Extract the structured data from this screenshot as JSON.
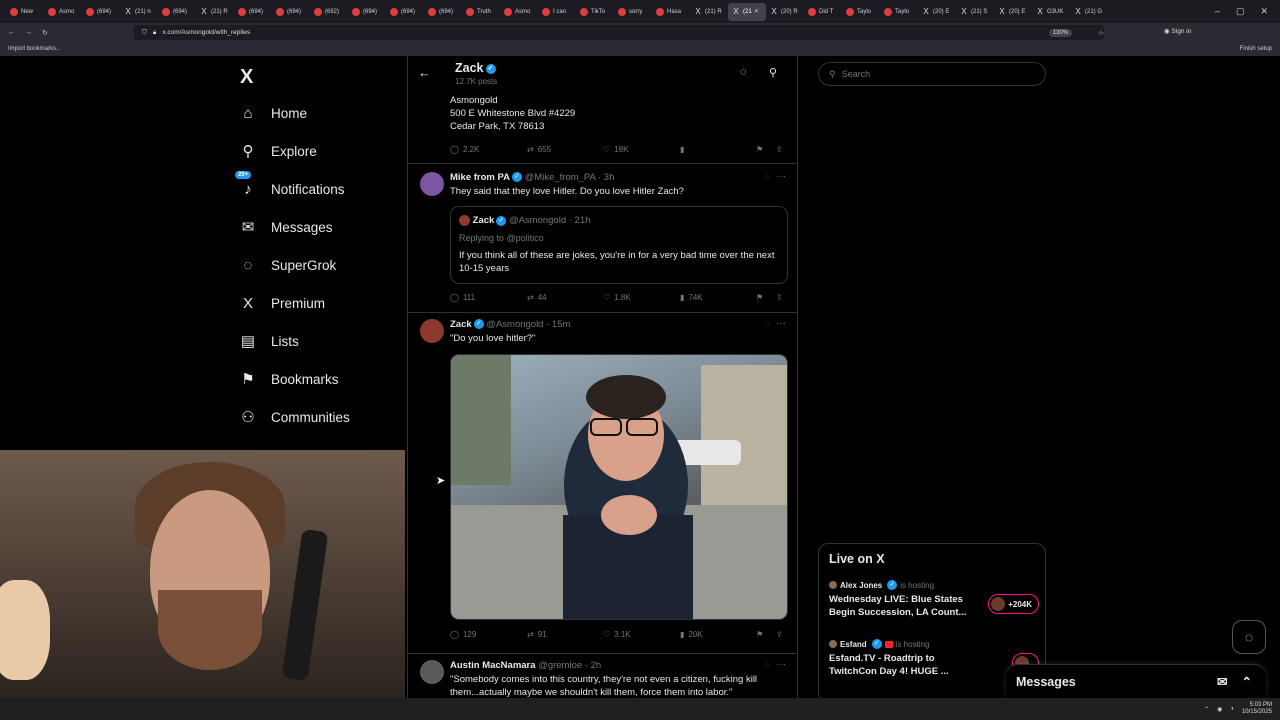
{
  "browser": {
    "tabs": [
      {
        "label": "New"
      },
      {
        "label": "Asmo"
      },
      {
        "label": "(694)"
      },
      {
        "label": "(21) n"
      },
      {
        "label": "(694)"
      },
      {
        "label": "(21) R"
      },
      {
        "label": "(694)"
      },
      {
        "label": "(694)"
      },
      {
        "label": "(692)"
      },
      {
        "label": "(694)"
      },
      {
        "label": "(694)"
      },
      {
        "label": "(694)"
      },
      {
        "label": "Truth"
      },
      {
        "label": "Asmo"
      },
      {
        "label": "I can"
      },
      {
        "label": "TikTo"
      },
      {
        "label": "sorry"
      },
      {
        "label": "Hasa"
      },
      {
        "label": "(21) R"
      },
      {
        "label": "(21"
      },
      {
        "label": "(20) R"
      },
      {
        "label": "Did T"
      },
      {
        "label": "Taylo"
      },
      {
        "label": "Taylo"
      },
      {
        "label": "(20) E"
      },
      {
        "label": "(21) S"
      },
      {
        "label": "(20) E"
      },
      {
        "label": "G3UK"
      },
      {
        "label": "(21) G"
      }
    ],
    "active_tab_index": 19,
    "url": "x.com/Asmongold/with_replies",
    "zoom": "130%",
    "sign_in": "Sign in",
    "bookmarks_import": "Import bookmarks...",
    "finish_setup": "Finish setup"
  },
  "nav": {
    "logo": "X",
    "items": [
      {
        "label": "Home",
        "icon": "home-icon",
        "glyph": "⌂"
      },
      {
        "label": "Explore",
        "icon": "search-icon",
        "glyph": "⚲"
      },
      {
        "label": "Notifications",
        "icon": "bell-icon",
        "glyph": "♪",
        "badge": "20+"
      },
      {
        "label": "Messages",
        "icon": "mail-icon",
        "glyph": "✉"
      },
      {
        "label": "SuperGrok",
        "icon": "grok-icon",
        "glyph": "◌"
      },
      {
        "label": "Premium",
        "icon": "x-premium-icon",
        "glyph": "X"
      },
      {
        "label": "Lists",
        "icon": "list-icon",
        "glyph": "▤"
      },
      {
        "label": "Bookmarks",
        "icon": "bookmark-icon",
        "glyph": "⚑"
      },
      {
        "label": "Communities",
        "icon": "communities-icon",
        "glyph": "⚇"
      }
    ]
  },
  "profile_header": {
    "name": "Zack",
    "posts": "12.7K posts"
  },
  "address_block": {
    "lines": [
      "Asmongold",
      "500 E Whitestone Blvd #4229",
      "Cedar Park, TX 78613"
    ],
    "replies": "2.2K",
    "reposts": "655",
    "likes": "18K"
  },
  "posts": [
    {
      "author": "Mike from PA",
      "handle": "@Mike_from_PA · 3h",
      "text": "They said that they love Hitler. Do you love Hitler Zach?",
      "quote": {
        "author": "Zack",
        "handle": "@Asmongold · 21h",
        "replying": "Replying to @politico",
        "text": "If you think all of these are jokes, you're in for a very bad time over the next 10-15 years"
      },
      "replies": "111",
      "reposts": "44",
      "likes": "1.8K",
      "views": "74K"
    },
    {
      "author": "Zack",
      "handle": "@Asmongold · 15m",
      "text": "\"Do you love hitler?\"",
      "replies": "129",
      "reposts": "91",
      "likes": "3.1K",
      "views": "20K"
    },
    {
      "author": "Austin MacNamara",
      "handle": "@gremloe · 2h",
      "text": "\"Somebody comes into this country, they're not even a citizen, fucking kill them...actually maybe we shouldn't kill them, force them into labor.\""
    }
  ],
  "right": {
    "search_placeholder": "Search",
    "live_title": "Live on X",
    "live": [
      {
        "host": "Alex Jones",
        "status": "is hosting",
        "title": "Wednesday LIVE: Blue States Begin Succession, LA Count...",
        "count": "+204K"
      },
      {
        "host": "Esfand",
        "status": "is hosting",
        "title": "Esfand.TV - Roadtrip to TwitchCon Day 4! HUGE ...",
        "count": ""
      }
    ],
    "messages_label": "Messages"
  },
  "taskbar": {
    "time": "5:03 PM",
    "date": "10/15/2025"
  },
  "colors": {
    "accent": "#1d9bf0",
    "border": "#2f3336",
    "muted": "#71767b",
    "live": "#f91880"
  }
}
